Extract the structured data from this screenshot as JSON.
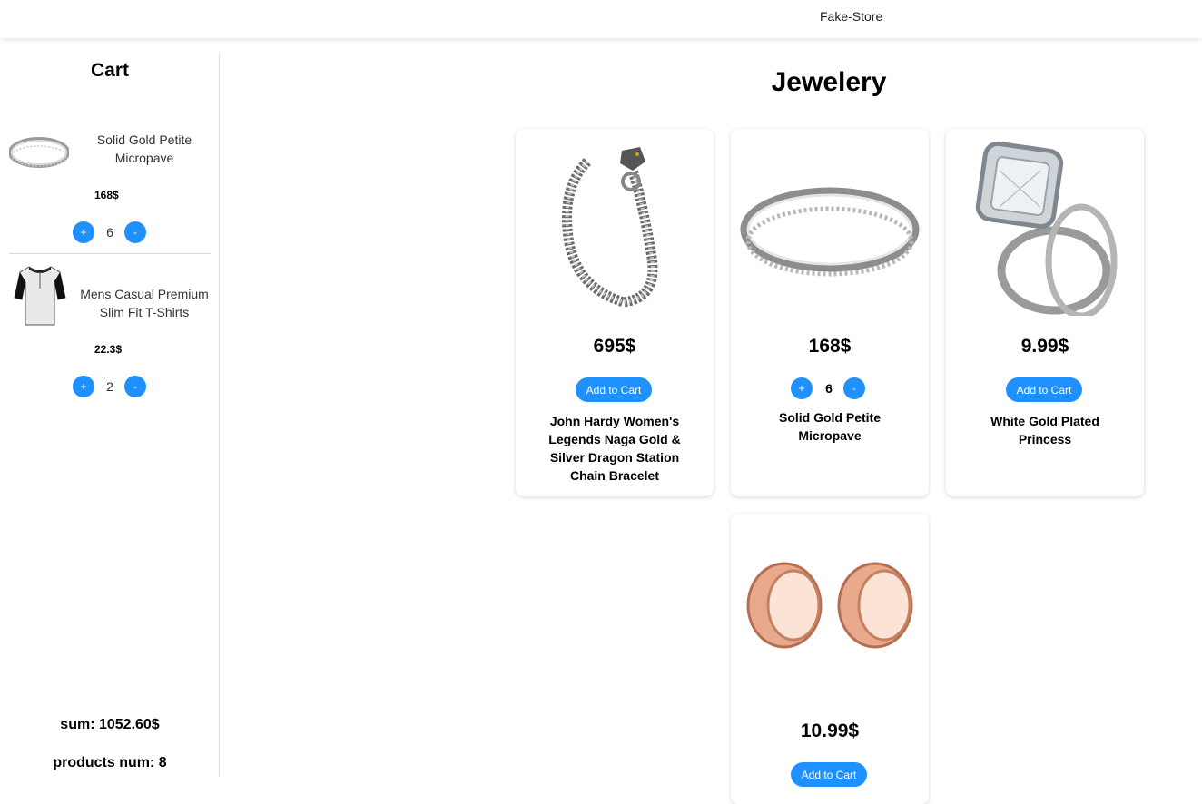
{
  "header": {
    "brand": "Fake-Store"
  },
  "cart": {
    "title": "Cart",
    "items": [
      {
        "name": "Solid Gold Petite Micropave",
        "price": "168$",
        "qty": "6",
        "icon": "ring-icon"
      },
      {
        "name": "Mens Casual Premium Slim Fit T-Shirts",
        "price": "22.3$",
        "qty": "2",
        "icon": "tshirt-icon"
      }
    ],
    "plus_label": "+",
    "minus_label": "-",
    "sum": "sum: 1052.60$",
    "products_num": "products num: 8"
  },
  "main": {
    "title": "Jewelery",
    "add_label": "Add to Cart",
    "products": [
      {
        "price": "695$",
        "name": "John Hardy Women's Legends Naga Gold & Silver Dragon Station Chain Bracelet",
        "icon": "bracelet-icon"
      },
      {
        "price": "168$",
        "name": "Solid Gold Petite Micropave",
        "qty": "6",
        "icon": "ring-icon"
      },
      {
        "price": "9.99$",
        "name": "White Gold Plated Princess",
        "icon": "diamond-ring-icon"
      },
      {
        "price": "10.99$",
        "name": "",
        "icon": "earring-plugs-icon"
      }
    ]
  },
  "colors": {
    "accent": "#1e90ff",
    "divider": "#dcdcdc"
  }
}
